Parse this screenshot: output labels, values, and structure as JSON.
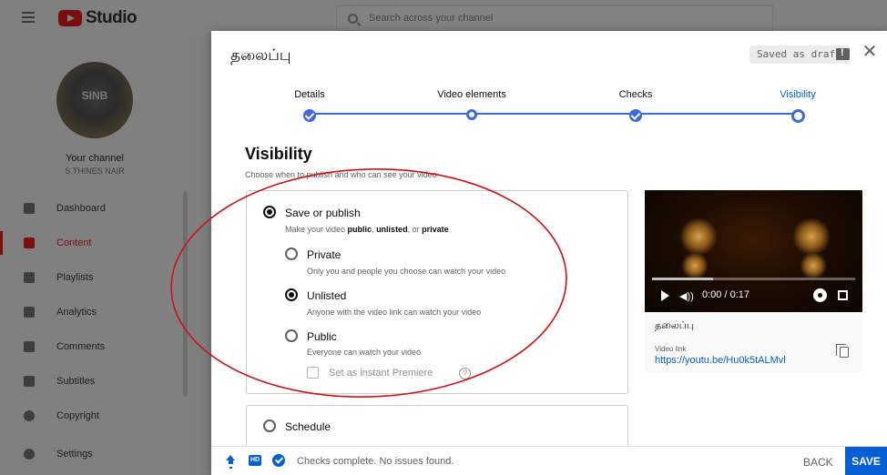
{
  "app": {
    "logo_text": "Studio",
    "search_placeholder": "Search across your channel"
  },
  "sidebar": {
    "avatar_text": "SINB",
    "channel_title": "Your channel",
    "channel_name": "S.THINES NAIR",
    "items": [
      {
        "label": "Dashboard",
        "icon": "dashboard-icon"
      },
      {
        "label": "Content",
        "icon": "content-icon",
        "active": true
      },
      {
        "label": "Playlists",
        "icon": "playlists-icon"
      },
      {
        "label": "Analytics",
        "icon": "analytics-icon"
      },
      {
        "label": "Comments",
        "icon": "comments-icon"
      },
      {
        "label": "Subtitles",
        "icon": "subtitles-icon"
      },
      {
        "label": "Copyright",
        "icon": "copyright-icon"
      }
    ],
    "settings_label": "Settings"
  },
  "modal": {
    "title": "தலைப்பு",
    "draft_status": "Saved as draft",
    "steps": [
      {
        "label": "Details",
        "state": "done"
      },
      {
        "label": "Video elements",
        "state": "pending"
      },
      {
        "label": "Checks",
        "state": "done"
      },
      {
        "label": "Visibility",
        "state": "current"
      }
    ],
    "section_title": "Visibility",
    "section_subtitle": "Choose when to publish and who can see your video",
    "save_publish": {
      "label": "Save or publish",
      "desc_prefix": "Make your video ",
      "desc_public": "public",
      "desc_sep1": ", ",
      "desc_unlisted": "unlisted",
      "desc_sep2": ", or ",
      "desc_private": "private",
      "selected": true
    },
    "options": [
      {
        "label": "Private",
        "desc": "Only you and people you choose can watch your video",
        "selected": false
      },
      {
        "label": "Unlisted",
        "desc": "Anyone with the video link can watch your video",
        "selected": true
      },
      {
        "label": "Public",
        "desc": "Everyone can watch your video",
        "selected": false
      }
    ],
    "premiere_label": "Set as instant Premiere",
    "help_glyph": "?",
    "schedule_label": "Schedule",
    "preview": {
      "time": "0:00 / 0:17",
      "played_fraction": 0.3,
      "video_title": "தலைப்பு",
      "link_label": "Video link",
      "link_value": "https://youtu.be/Hu0k5tALMvl"
    },
    "footer": {
      "status": "Checks complete. No issues found.",
      "hd_text": "HD",
      "back_label": "BACK",
      "save_label": "SAVE"
    }
  },
  "colors": {
    "accent": "#065fd4",
    "annotation": "#d11111"
  }
}
